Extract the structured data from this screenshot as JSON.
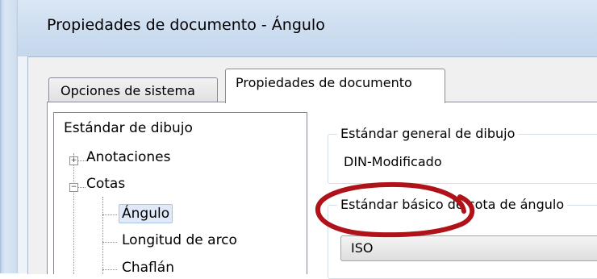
{
  "window": {
    "title": "Propiedades de documento - Ángulo"
  },
  "tabs": [
    {
      "label": "Opciones de sistema",
      "active": false
    },
    {
      "label": "Propiedades de documento",
      "active": true
    }
  ],
  "tree": {
    "items": [
      {
        "label": "Estándar de dibujo"
      },
      {
        "label": "Anotaciones",
        "expander": "+"
      },
      {
        "label": "Cotas",
        "expander": "−"
      },
      {
        "label": "Ángulo",
        "selected": true
      },
      {
        "label": "Longitud de arco"
      },
      {
        "label": "Chaflán"
      }
    ]
  },
  "panel": {
    "general_group_label": "Estándar general de dibujo",
    "general_value": "DIN-Modificado",
    "angle_group_label": "Estándar básico de cota de ángulo",
    "angle_select_value": "ISO"
  },
  "annotation": {
    "color": "#b0121a",
    "shape": "hand-drawn-ellipse"
  }
}
